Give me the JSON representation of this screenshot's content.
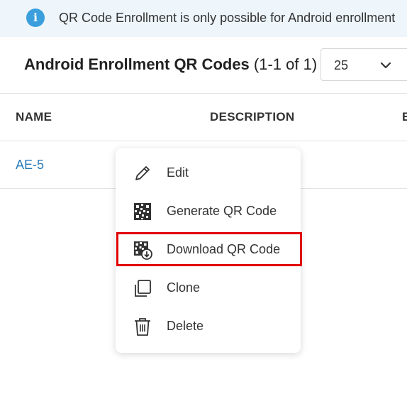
{
  "banner": {
    "icon": "info-icon",
    "icon_glyph": "i",
    "accent_color": "#3a9fdc",
    "text": "QR Code Enrollment is only possible for Android enrollment"
  },
  "header": {
    "title": "Android Enrollment QR Codes",
    "count": "(1-1 of 1)",
    "page_size": "25"
  },
  "table": {
    "columns": [
      "NAME",
      "DESCRIPTION",
      "E"
    ],
    "rows": [
      {
        "name": "AE-5"
      }
    ]
  },
  "menu": {
    "items": [
      {
        "label": "Edit",
        "icon": "pencil-icon"
      },
      {
        "label": "Generate QR Code",
        "icon": "qr-code-icon"
      },
      {
        "label": "Download QR Code",
        "icon": "qr-download-icon"
      },
      {
        "label": "Clone",
        "icon": "clone-icon"
      },
      {
        "label": "Delete",
        "icon": "trash-icon"
      }
    ],
    "highlighted_item": "Download QR Code",
    "highlight_color": "#e10000"
  }
}
